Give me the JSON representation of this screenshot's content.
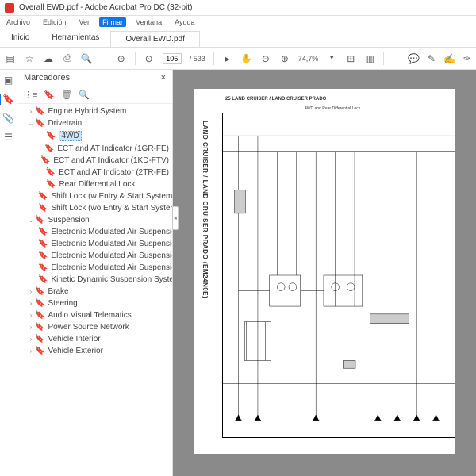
{
  "window": {
    "title": "Overall EWD.pdf - Adobe Acrobat Pro DC (32-bit)"
  },
  "menubar": {
    "archivo": "Archivo",
    "edicion": "Edición",
    "ver": "Ver",
    "firmar": "Firmar",
    "ventana": "Ventana",
    "ayuda": "Ayuda"
  },
  "tabs": {
    "inicio": "Inicio",
    "herramientas": "Herramientas",
    "doc": "Overall EWD.pdf"
  },
  "toolbar": {
    "page_current": "105",
    "page_total": "/ 533",
    "zoom": "74,7%"
  },
  "sidebar": {
    "title": "Marcadores",
    "close": "×"
  },
  "tree": {
    "engine": "Engine  Hybrid System",
    "drivetrain": "Drivetrain",
    "fourwd": "4WD",
    "ect1": "ECT and AT Indicator (1GR-FE)",
    "ect2": "ECT and AT Indicator (1KD-FTV)",
    "ect3": "ECT and AT Indicator (2TR-FE)",
    "rdl": "Rear Differential Lock",
    "sl1": "Shift Lock (w Entry & Start System)",
    "sl2": "Shift Lock (wo Entry & Start System)",
    "suspension": "Suspension",
    "emas1": "Electronic Modulated Air Suspension (",
    "emas2": "Electronic Modulated Air Suspension (",
    "emas3": "Electronic Modulated Air Suspension (",
    "emas4": "Electronic Modulated Air Suspension (",
    "kdss": "Kinetic Dynamic Suspension System",
    "brake": "Brake",
    "steering": "Steering",
    "avt": "Audio Visual Telematics",
    "psn": "Power Source  Network",
    "vint": "Vehicle Interior",
    "vext": "Vehicle Exterior"
  },
  "page": {
    "vtitle": "LAND CRUISER / LAND CRUISER PRADO (EM24N0E)",
    "htitle": "25 LAND CRUISER / LAND CRUISER PRADO",
    "subtitle": "4WD and Rear Differential Lock"
  }
}
